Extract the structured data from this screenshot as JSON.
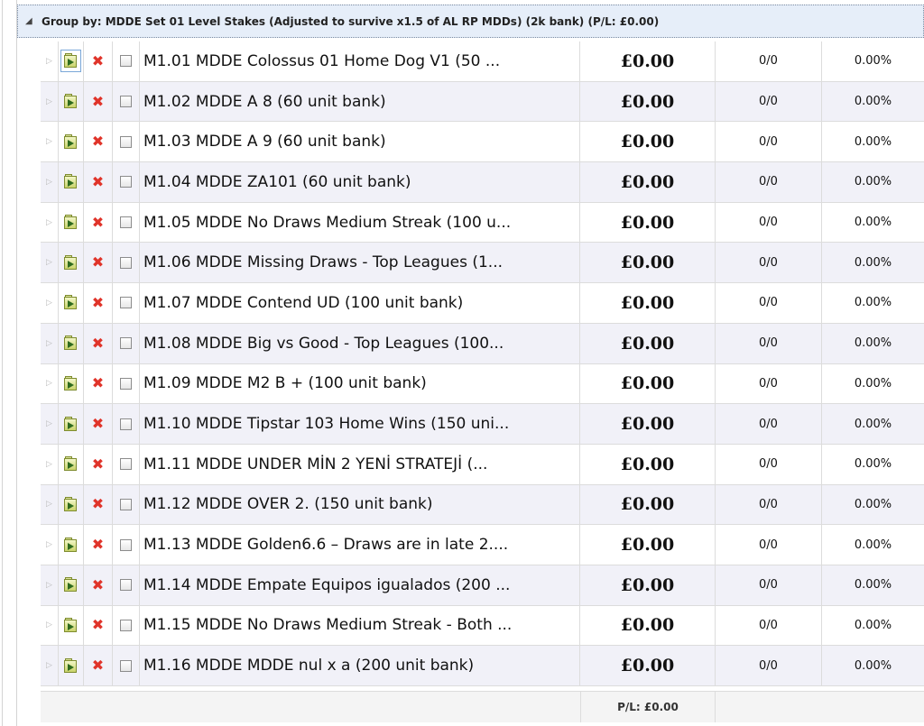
{
  "group": {
    "label": "Group by: MDDE Set 01 Level Stakes (Adjusted to survive x1.5 of AL RP MDDs) (2k bank) (P/L: £0.00)"
  },
  "rows": [
    {
      "name": "M1.01 MDDE Colossus 01 Home Dog V1 (50 ...",
      "pl": "£0.00",
      "bets": "0/0",
      "pct": "0.00%"
    },
    {
      "name": "M1.02 MDDE A 8 (60 unit bank)",
      "pl": "£0.00",
      "bets": "0/0",
      "pct": "0.00%"
    },
    {
      "name": "M1.03 MDDE A 9 (60 unit bank)",
      "pl": "£0.00",
      "bets": "0/0",
      "pct": "0.00%"
    },
    {
      "name": "M1.04 MDDE ZA101 (60 unit bank)",
      "pl": "£0.00",
      "bets": "0/0",
      "pct": "0.00%"
    },
    {
      "name": "M1.05 MDDE No Draws Medium Streak (100 u...",
      "pl": "£0.00",
      "bets": "0/0",
      "pct": "0.00%"
    },
    {
      "name": "M1.06 MDDE Missing Draws - Top Leagues (1...",
      "pl": "£0.00",
      "bets": "0/0",
      "pct": "0.00%"
    },
    {
      "name": "M1.07 MDDE Contend UD (100 unit bank)",
      "pl": "£0.00",
      "bets": "0/0",
      "pct": "0.00%"
    },
    {
      "name": "M1.08 MDDE Big vs Good - Top Leagues (100...",
      "pl": "£0.00",
      "bets": "0/0",
      "pct": "0.00%"
    },
    {
      "name": "M1.09 MDDE M2 B + (100 unit bank)",
      "pl": "£0.00",
      "bets": "0/0",
      "pct": "0.00%"
    },
    {
      "name": "M1.10 MDDE Tipstar 103 Home Wins (150 uni...",
      "pl": "£0.00",
      "bets": "0/0",
      "pct": "0.00%"
    },
    {
      "name": "M1.11 MDDE UNDER MİN 2 YENİ STRATEJİ (...",
      "pl": "£0.00",
      "bets": "0/0",
      "pct": "0.00%"
    },
    {
      "name": "M1.12 MDDE OVER 2. (150 unit bank)",
      "pl": "£0.00",
      "bets": "0/0",
      "pct": "0.00%"
    },
    {
      "name": "M1.13 MDDE Golden6.6 – Draws are in late 2....",
      "pl": "£0.00",
      "bets": "0/0",
      "pct": "0.00%"
    },
    {
      "name": "M1.14 MDDE Empate Equipos igualados (200 ...",
      "pl": "£0.00",
      "bets": "0/0",
      "pct": "0.00%"
    },
    {
      "name": "M1.15 MDDE No Draws Medium Streak - Both ...",
      "pl": "£0.00",
      "bets": "0/0",
      "pct": "0.00%"
    },
    {
      "name": "M1.16 MDDE MDDE nul x a (200 unit bank)",
      "pl": "£0.00",
      "bets": "0/0",
      "pct": "0.00%"
    }
  ],
  "icons": {
    "expand": "expand-arrow-icon",
    "go": "open-system-icon",
    "delete": "delete-x-icon",
    "collapse": "collapse-triangle-icon"
  },
  "colors": {
    "delete": "#e0342a",
    "header_bg": "#e6eef9",
    "alt_row": "#f1f1f8"
  },
  "footer": {
    "total": "P/L: £0.00"
  }
}
